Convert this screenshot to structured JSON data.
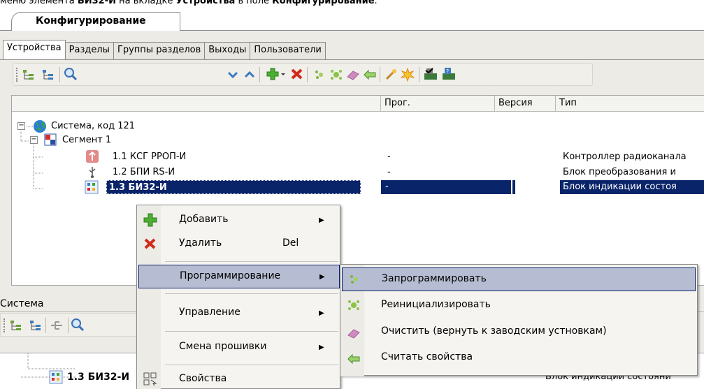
{
  "caption": {
    "prefix": "меню элемента ",
    "bold1": "БИ32-И",
    "mid": " на вкладке ",
    "bold2": "Устройства",
    "mid2": " в поле ",
    "bold3": "Конфигурирование",
    "suffix": "."
  },
  "main_tab": "Конфигурирование",
  "subtabs": [
    "Устройства",
    "Разделы",
    "Группы разделов",
    "Выходы",
    "Пользователи"
  ],
  "columns": {
    "name": "",
    "prog": "Прог.",
    "version": "Версия",
    "type": "Тип"
  },
  "tree": {
    "root": "Система, код 121",
    "segment": "Сегмент 1",
    "items": [
      {
        "name": "1.1 КСГ РРОП-И",
        "prog": "-",
        "type": "Контроллер радиоканала"
      },
      {
        "name": "1.2 БПИ RS-И",
        "prog": "-",
        "type": "Блок преобразования и"
      },
      {
        "name": "1.3 БИ32-И",
        "prog": "-",
        "type": "Блок индикации состоя"
      }
    ]
  },
  "lower": {
    "title": "Система",
    "row_name": "1.3 БИ32-И",
    "row_type": "Блок индикации состояни"
  },
  "context_menu": {
    "items": [
      {
        "label": "Добавить",
        "shortcut": "",
        "submenu": true,
        "icon": "green-plus-icon"
      },
      {
        "label": "Удалить",
        "shortcut": "Del",
        "submenu": false,
        "icon": "red-x-icon"
      },
      {
        "label": "Программирование",
        "shortcut": "",
        "submenu": true,
        "icon": ""
      },
      {
        "label": "Управление",
        "shortcut": "",
        "submenu": true,
        "icon": ""
      },
      {
        "label": "Смена прошивки",
        "shortcut": "",
        "submenu": true,
        "icon": ""
      },
      {
        "label": "Свойства",
        "shortcut": "",
        "submenu": false,
        "icon": "properties-icon"
      }
    ]
  },
  "submenu": {
    "items": [
      {
        "label": "Запрограммировать",
        "icon": "program-icon"
      },
      {
        "label": "Реинициализировать",
        "icon": "reinit-icon"
      },
      {
        "label": "Очистить (вернуть к заводским устновкам)",
        "icon": "eraser-icon"
      },
      {
        "label": "Считать свойства",
        "icon": "read-props-icon"
      }
    ]
  },
  "colors": {
    "selection": "#0a246a",
    "menu_highlight": "#b6bdd2",
    "panel": "#ecebe6"
  }
}
